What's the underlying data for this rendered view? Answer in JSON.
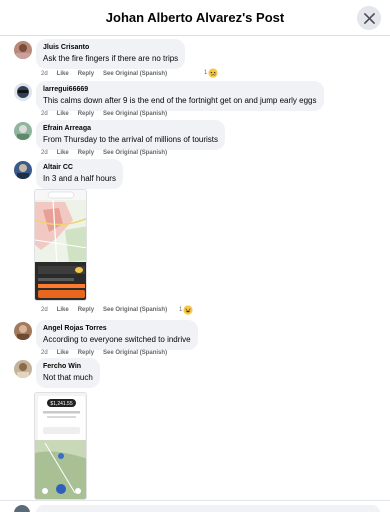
{
  "header": {
    "title": "Johan Alberto Alvarez's Post"
  },
  "actions": {
    "like": "Like",
    "reply": "Reply",
    "see_original": "See Original (Spanish)"
  },
  "comments": [
    {
      "author": "Jluis Crisanto",
      "text": "Ask the fire fingers if there are no trips",
      "time": "2d",
      "reaction_count": "1",
      "reaction_icon": "sad-emoji-icon"
    },
    {
      "author": "larregui66669",
      "text": "This calms down after 9 is the end of the fortnight get on and jump early eggs",
      "time": "2d"
    },
    {
      "author": "Efrain Arreaga",
      "text": "From Thursday to the arrival of millions of tourists",
      "time": "2d"
    },
    {
      "author": "Altair CC",
      "text": "In 3 and a half hours",
      "time": "2d",
      "reaction_count": "1",
      "reaction_icon": "haha-emoji-icon"
    },
    {
      "author": "Angel Rojas Torres",
      "text": "According to everyone switched to indrive",
      "time": "2d"
    },
    {
      "author": "Fercho Win",
      "text": "Not that much",
      "time": ""
    }
  ],
  "screenshot_price": "$1,241.55",
  "colors": {
    "bubble": "#f0f2f5",
    "meta": "#65676b",
    "header_border": "#dadde1"
  }
}
